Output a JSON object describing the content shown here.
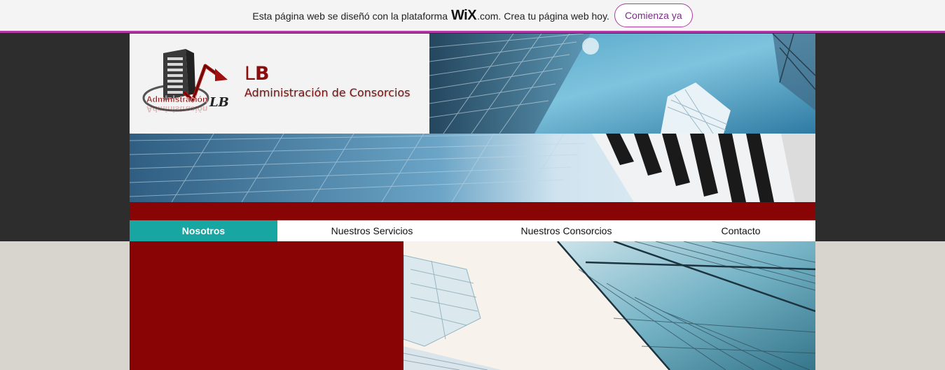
{
  "wix_banner": {
    "text_before": "Esta página web se diseñó con la plataforma",
    "wix_logo": "WiX",
    "text_after": ".com. Crea tu página web hoy.",
    "cta_label": "Comienza ya"
  },
  "header": {
    "brand_letter_l": "L",
    "brand_letter_b": "B",
    "subtitle": "Administración de Consorcios",
    "logo_text": "Administración",
    "logo_mark": "LB"
  },
  "nav": {
    "items": [
      {
        "label": "Nosotros"
      },
      {
        "label": "Nuestros Servicios"
      },
      {
        "label": "Nuestros Consorcios"
      },
      {
        "label": "Contacto"
      }
    ]
  },
  "colors": {
    "accent_teal": "#17a6a1",
    "brand_red": "#890505",
    "wix_purple": "#b23aa2"
  }
}
